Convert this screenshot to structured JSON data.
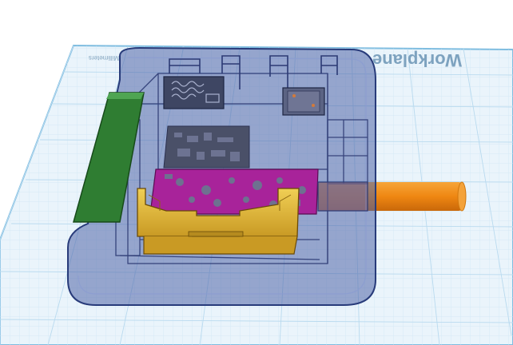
{
  "scene": {
    "workplane_label": "Workplane",
    "workplane_units_label": "Millimeters"
  },
  "colors": {
    "workplane_fill": "#eaf4fb",
    "workplane_grid": "#b9daef",
    "workplane_border": "#7fbde0",
    "enclosure_fill": "#4f64a8",
    "enclosure_edge": "#283b7a",
    "green_board": "#2f7d32",
    "magenta_board": "#a8239a",
    "yellow_holder": "#e2bb3c",
    "orange_rod": "#f08a16",
    "dark_board": "#4a5068"
  },
  "objects": [
    {
      "name": "workplane-grid",
      "type": "workplane"
    },
    {
      "name": "transparent-enclosure",
      "type": "box-hole"
    },
    {
      "name": "green-pcb-strip",
      "type": "board"
    },
    {
      "name": "magenta-pcb",
      "type": "board"
    },
    {
      "name": "yellow-battery-holder",
      "type": "holder"
    },
    {
      "name": "orange-cylinder",
      "type": "cylinder"
    },
    {
      "name": "dark-module-board",
      "type": "board"
    },
    {
      "name": "sensor-module",
      "type": "board"
    },
    {
      "name": "relay-module",
      "type": "board"
    }
  ]
}
